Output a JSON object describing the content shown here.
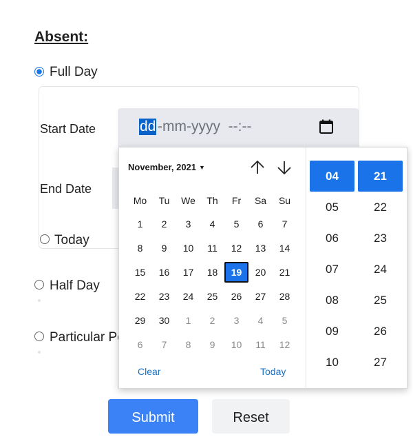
{
  "form": {
    "heading": "Absent:",
    "full_day_label": "Full Day",
    "start_date_label": "Start Date",
    "end_date_label": "End Date",
    "today_label": "Today",
    "half_day_label": "Half Day",
    "particular_label": "Particular Po",
    "date_input": {
      "day_part": "dd",
      "rest": "-mm-yyyy  --:--"
    },
    "submit_label": "Submit",
    "reset_label": "Reset"
  },
  "picker": {
    "month_label": "November, 2021",
    "weekdays": [
      "Mo",
      "Tu",
      "We",
      "Th",
      "Fr",
      "Sa",
      "Su"
    ],
    "weeks": [
      [
        [
          "1",
          0
        ],
        [
          "2",
          0
        ],
        [
          "3",
          0
        ],
        [
          "4",
          0
        ],
        [
          "5",
          0
        ],
        [
          "6",
          0
        ],
        [
          "7",
          0
        ]
      ],
      [
        [
          "8",
          0
        ],
        [
          "9",
          0
        ],
        [
          "10",
          0
        ],
        [
          "11",
          0
        ],
        [
          "12",
          0
        ],
        [
          "13",
          0
        ],
        [
          "14",
          0
        ]
      ],
      [
        [
          "15",
          0
        ],
        [
          "16",
          0
        ],
        [
          "17",
          0
        ],
        [
          "18",
          0
        ],
        [
          "19",
          2
        ],
        [
          "20",
          0
        ],
        [
          "21",
          0
        ]
      ],
      [
        [
          "22",
          0
        ],
        [
          "23",
          0
        ],
        [
          "24",
          0
        ],
        [
          "25",
          0
        ],
        [
          "26",
          0
        ],
        [
          "27",
          0
        ],
        [
          "28",
          0
        ]
      ],
      [
        [
          "29",
          0
        ],
        [
          "30",
          0
        ],
        [
          "1",
          1
        ],
        [
          "2",
          1
        ],
        [
          "3",
          1
        ],
        [
          "4",
          1
        ],
        [
          "5",
          1
        ]
      ],
      [
        [
          "6",
          1
        ],
        [
          "7",
          1
        ],
        [
          "8",
          1
        ],
        [
          "9",
          1
        ],
        [
          "10",
          1
        ],
        [
          "11",
          1
        ],
        [
          "12",
          1
        ]
      ]
    ],
    "clear_label": "Clear",
    "today_label": "Today",
    "hours": [
      "04",
      "05",
      "06",
      "07",
      "08",
      "09",
      "10"
    ],
    "minutes": [
      "21",
      "22",
      "23",
      "24",
      "25",
      "26",
      "27"
    ],
    "selected_hour": "04",
    "selected_minute": "21",
    "selected_day": "19"
  },
  "colors": {
    "accent": "#1a73e8",
    "submit_bg": "#3b82f6",
    "link": "#1a6fc0"
  }
}
